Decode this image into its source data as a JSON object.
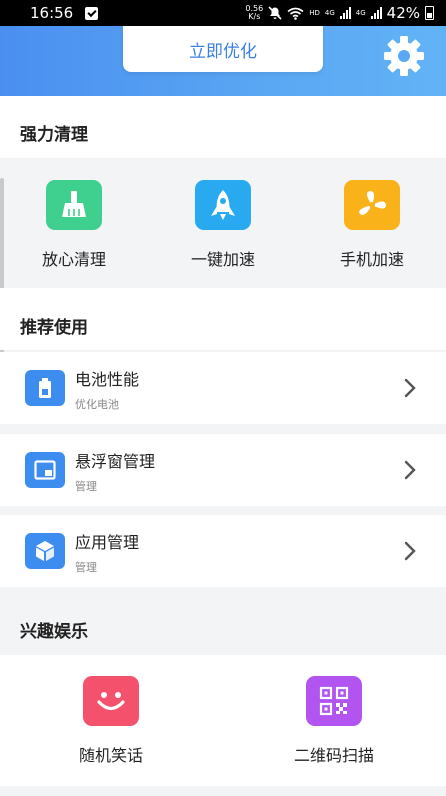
{
  "status_bar": {
    "time": "16:56",
    "speed_value": "0.56",
    "speed_unit": "K/s",
    "hd_label": "HD",
    "net1": "4G",
    "net2": "4G",
    "battery": "42%"
  },
  "header": {
    "optimize_label": "立即优化",
    "settings_icon": "gear-icon"
  },
  "sections": {
    "clean_title": "强力清理",
    "recommend_title": "推荐使用",
    "fun_title": "兴趣娱乐"
  },
  "clean_tiles": [
    {
      "label": "放心清理",
      "icon": "broom-icon",
      "color": "#3fcf8e"
    },
    {
      "label": "一键加速",
      "icon": "rocket-icon",
      "color": "#28a9f0"
    },
    {
      "label": "手机加速",
      "icon": "fan-icon",
      "color": "#f9b21a"
    }
  ],
  "recommend_items": [
    {
      "title": "电池性能",
      "subtitle": "优化电池",
      "icon": "battery-icon"
    },
    {
      "title": "悬浮窗管理",
      "subtitle": "管理",
      "icon": "floating-window-icon"
    },
    {
      "title": "应用管理",
      "subtitle": "管理",
      "icon": "cube-icon"
    }
  ],
  "fun_tiles": [
    {
      "label": "随机笑话",
      "icon": "smile-icon",
      "color": "#f4516c"
    },
    {
      "label": "二维码扫描",
      "icon": "qr-code-icon",
      "color": "#b154f0"
    }
  ]
}
